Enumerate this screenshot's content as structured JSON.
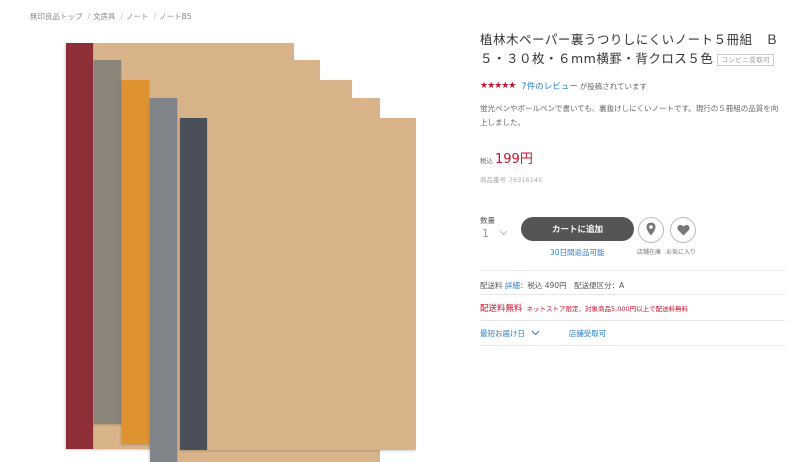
{
  "breadcrumb": {
    "items": [
      "無印良品トップ",
      "文房具",
      "ノート",
      "ノートB5"
    ],
    "separator": "/"
  },
  "product": {
    "title": "植林木ペーパー裏うつりしにくいノート５冊組　Ｂ５・３０枚・６mm横罫・背クロス５色",
    "convenience_badge": "コンビニ受取可",
    "rating": {
      "stars_text": "★★★★★",
      "review_link": "7件のレビュー",
      "review_suffix": "が投稿されています"
    },
    "description": "蛍光ペンやボールペンで書いても、裏抜けしにくいノートです。現行の５冊組の品質を向上しました。",
    "tax_label": "税込",
    "price": "199円",
    "item_no_label": "商品番号",
    "item_no": "76316145",
    "spine_colors": [
      "#8e2e36",
      "#8a8479",
      "#df9330",
      "#808387",
      "#4a4f5a"
    ],
    "cover_color": "#d9b38a"
  },
  "purchase": {
    "qty_label": "数量",
    "qty_value": "1",
    "cart_button": "カートに追加",
    "return_note": "30日間返品可能",
    "store_stock_caption": "店舗在庫",
    "favorite_caption": "お気に入り"
  },
  "shipping": {
    "fee_label": "配送料",
    "fee_link": "詳細",
    "fee_text": "：税込 490円　配送便区分：A",
    "free_label": "配送料無料",
    "free_note": "ネットストア限定、対象商品5,000円以上で配送料無料",
    "earliest_delivery": "最短お届け日",
    "store_pickup": "店舗受取可"
  }
}
